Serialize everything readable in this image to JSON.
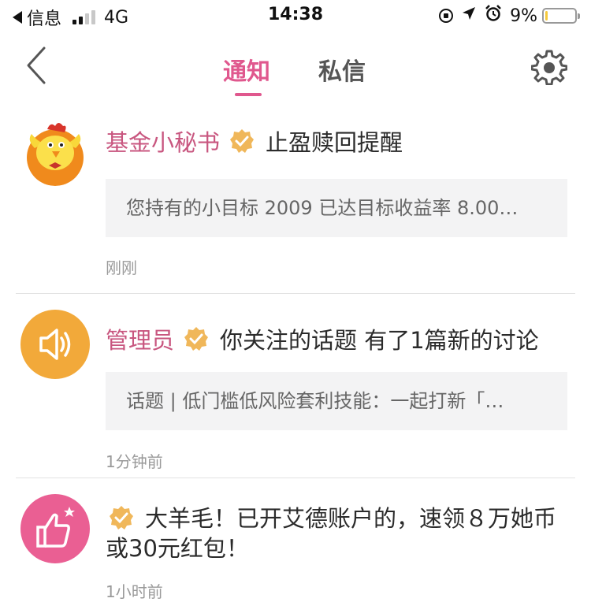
{
  "status_bar": {
    "back_app": "信息",
    "network": "4G",
    "time": "14:38",
    "battery_pct": "9%",
    "battery_level": 0.09
  },
  "nav": {
    "tab_active": "通知",
    "tab_inactive": "私信"
  },
  "notifications": [
    {
      "sender": "基金小秘书",
      "title": "止盈赎回提醒",
      "preview": "您持有的小目标 2009 已达目标收益率 8.00…",
      "time": "刚刚"
    },
    {
      "sender": "管理员",
      "title": "你关注的话题 有了1篇新的讨论",
      "preview": "话题 | 低门槛低风险套利技能：一起打新「…",
      "time": "1分钟前"
    },
    {
      "sender": "",
      "title": "大羊毛！已开艾德账户的，速领８万她币或30元红包！",
      "time": "1小时前"
    }
  ],
  "colors": {
    "accent": "#e0588e",
    "sender": "#c8567f",
    "verified": "#f0b75a",
    "speaker_avatar": "#f2a93a",
    "like_avatar": "#ea5f93"
  }
}
